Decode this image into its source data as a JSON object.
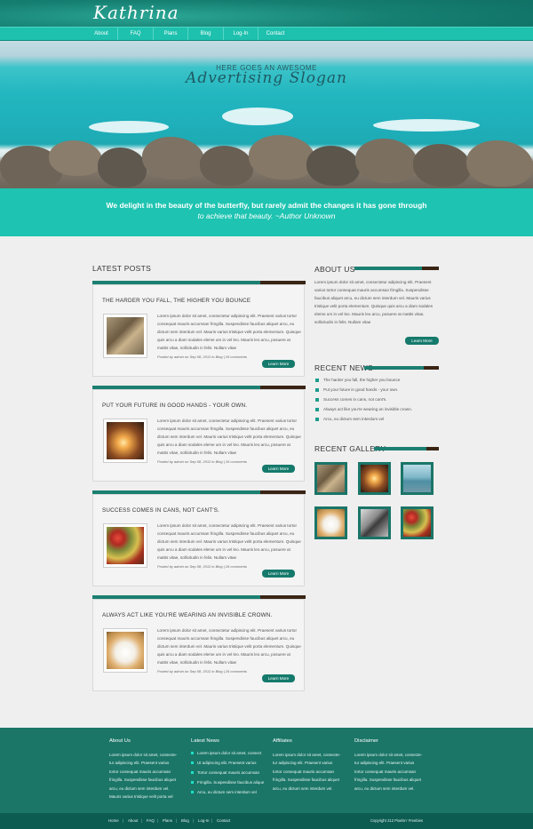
{
  "header": {
    "logo": "Kathrina",
    "nav": [
      "About",
      "FAQ",
      "Plans",
      "Blog",
      "Log-In",
      "Contact"
    ]
  },
  "hero": {
    "slogan_small": "HERE GOES AN AWESOME",
    "slogan_big": "Advertising Slogan"
  },
  "quote": {
    "line1": "We delight in the beauty of the butterfly, but rarely admit the changes it has gone through",
    "line2": "to achieve that beauty. ~Author Unknown"
  },
  "latest_posts": {
    "title": "LATEST POSTS",
    "posts": [
      {
        "title": "THE HARDER YOU FALL, THE HIGHER YOU BOUNCE",
        "thumb_icon": "seashell-image",
        "text": "Lorem ipsum dolor sit amet, consectetur adipiscing elit. Praesent varius tortor consequat mauris accumsan fringilla. Suspendisse faucibus aliquet arcu, eu dictum sem interdum vel. Mauris varius tristique velit porta elementum. Quisque quis arcu a diam sodales eleme um in vel leo. Mauris leo arcu, posuere at mattis vitae, sollicitudin in felis. Nullam vitae",
        "meta": "Posted by admin on Sep 08, 2012 in Blog | 26 comments",
        "button": "Learn More"
      },
      {
        "title": "PUT YOUR FUTURE IN GOOD HANDS - YOUR OWN.",
        "thumb_icon": "sunset-image",
        "text": "Lorem ipsum dolor sit amet, consectetur adipiscing elit. Praesent varius tortor consequat mauris accumsan fringilla. Suspendisse faucibus aliquet arcu, eu dictum sem interdum vel. Mauris varius tristique velit porta elementum. Quisque quis arcu a diam sodales eleme um in vel leo. Mauris leo arcu, posuere at mattis vitae, sollicitudin in felis. Nullam vitae",
        "meta": "Posted by admin on Sep 08, 2012 in Blog | 26 comments",
        "button": "Learn More"
      },
      {
        "title": "SUCCESS COMES IN CANS, NOT CANT'S.",
        "thumb_icon": "berries-image",
        "text": "Lorem ipsum dolor sit amet, consectetur adipiscing elit. Praesent varius tortor consequat mauris accumsan fringilla. Suspendisse faucibus aliquet arcu, eu dictum sem interdum vel. Mauris varius tristique velit porta elementum. Quisque quis arcu a diam sodales eleme um in vel leo. Mauris leo arcu, posuere at mattis vitae, sollicitudin in felis. Nullam vitae",
        "meta": "Posted by admin on Sep 08, 2012 in Blog | 26 comments",
        "button": "Learn More"
      },
      {
        "title": "ALWAYS ACT LIKE YOU'RE WEARING AN INVISIBLE CROWN.",
        "thumb_icon": "kitten-image",
        "text": "Lorem ipsum dolor sit amet, consectetur adipiscing elit. Praesent varius tortor consequat mauris accumsan fringilla. Suspendisse faucibus aliquet arcu, eu dictum sem interdum vel. Mauris varius tristique velit porta elementum. Quisque quis arcu a diam sodales eleme um in vel leo. Mauris leo arcu, posuere at mattis vitae, sollicitudin in felis. Nullam vitae",
        "meta": "Posted by admin on Sep 08, 2012 in Blog | 26 comments",
        "button": "Learn More"
      }
    ]
  },
  "sidebar": {
    "about": {
      "title": "ABOUT US",
      "text": "Lorem ipsum dolor sit amet, consectetur adipiscing elit. Praesent varius tortor consequat mauris accumsan fringilla. Suspendisse faucibus aliquet arcu, eu dictum sem interdum vel. Mauris varius tristique velit porta elementum. Quisque quis arcu a diam sodales eleme um in vel leo. Mauris leo arcu, posuere at mattis vitae, sollicitudin in felis. Nullam vitae",
      "button": "Learn More"
    },
    "news": {
      "title": "RECENT NEWS",
      "items": [
        "The harder you fall, the higher you bounce",
        "Put your future in good hands - your own.",
        "Success comes in cans, not cant's.",
        "Always act like you're wearing an invisible crown.",
        "Arcu, eu dictum sem interdum vel"
      ]
    },
    "gallery": {
      "title": "RECENT GALLERY",
      "images": [
        "seashell-image",
        "sunset-image",
        "sea-image",
        "kitten-image",
        "bird-image",
        "berries-image"
      ]
    }
  },
  "footer": {
    "about": {
      "title": "About Us",
      "text": "Lorem ipsum dolor sit amet, consecte- tur adipiscing elit. Praesent varius tortor consequat mauris accumsan fringilla. Suspendisse faucibus aliquet arcu, eu dictum sem interdum vel. Mauris varius tristique velit porta vel"
    },
    "news": {
      "title": "Latest News",
      "items": [
        "Lorem ipsum dolor sit amet, consect",
        "Ut adipiscing elit. Praesent varius",
        "Tortor consequat mauris accumsan",
        "Fringilla. Suspendisse faucibus alique",
        "Arcu, eu dictum sem interdum vel"
      ]
    },
    "affiliates": {
      "title": "Affiliates",
      "text": "Lorem ipsum dolor sit amet, consecte- tur adipiscing elit. Praesent varius tortor consequat mauris accumsan fringilla. Suspendisse faucibus aliquet arcu, eu dictum sem interdum vel."
    },
    "disclaimer": {
      "title": "Disclaimer",
      "text": "Lorem ipsum dolor sit amet, consecte- tur adipiscing elit. Praesent varius tortor consequat mauris accumsan fringilla. Suspendisse faucibus aliquet arcu, eu dictum sem interdum vel."
    }
  },
  "subfooter": {
    "links": [
      "Home",
      "About",
      "FAQ",
      "Plans",
      "Blog",
      "Log-In",
      "Contact"
    ],
    "separator": "|",
    "copyright": "Copyright 212 Pixelsn' Freebies"
  },
  "colors": {
    "brand_teal": "#1ec4b1",
    "dark_teal": "#1b7668",
    "accent_dark": "#3a2414",
    "button": "#157a6c"
  }
}
